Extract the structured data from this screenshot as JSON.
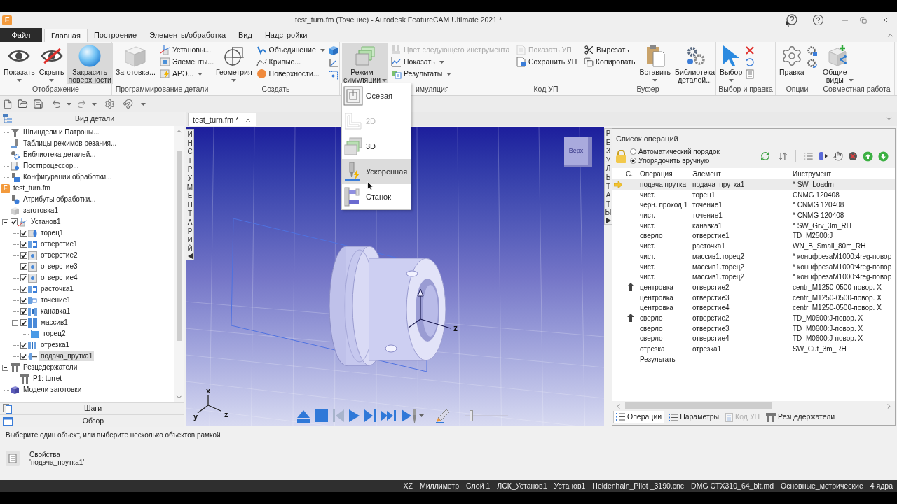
{
  "window": {
    "logo": "F",
    "title": "test_turn.fm (Точение) - Autodesk FeatureCAM Ultimate 2021 *"
  },
  "ribbon_tabs": [
    {
      "kind": "file",
      "label": "Файл",
      "selected": false
    },
    {
      "kind": "tab",
      "label": "Главная",
      "selected": true
    },
    {
      "kind": "tab",
      "label": "Построение",
      "selected": false
    },
    {
      "kind": "tab",
      "label": "Элементы/обработка",
      "selected": false
    },
    {
      "kind": "tab",
      "label": "Вид",
      "selected": false
    },
    {
      "kind": "tab",
      "label": "Надстройки",
      "selected": false
    }
  ],
  "ribbon_groups": [
    {
      "label": "Отображение",
      "buttons": [
        {
          "kind": "large",
          "label": "Показать",
          "caret": true,
          "selected": false
        },
        {
          "kind": "large",
          "label": "Скрыть",
          "caret": true,
          "selected": false
        },
        {
          "kind": "large",
          "label": "Закрасить поверхности",
          "selected": true
        }
      ]
    },
    {
      "label": "Программирование детали",
      "buttons": [
        {
          "kind": "large",
          "label": "Заготовка...",
          "selected": false
        },
        {
          "kind": "small",
          "label": "Установы...",
          "disabled": false
        },
        {
          "kind": "small",
          "label": "Элементы...",
          "disabled": false
        },
        {
          "kind": "small",
          "label": "АРЭ...",
          "caret": true,
          "disabled": false
        }
      ]
    },
    {
      "label": "Создать",
      "buttons": [
        {
          "kind": "large",
          "label": "Геометрия",
          "caret": true,
          "selected": false
        },
        {
          "kind": "small",
          "label": "Объединение",
          "caret": true,
          "disabled": false
        },
        {
          "kind": "small",
          "label": "Кривые...",
          "disabled": false
        },
        {
          "kind": "small",
          "label": "Поверхности...",
          "disabled": false
        },
        {
          "kind": "icon"
        },
        {
          "kind": "icon"
        },
        {
          "kind": "icon"
        }
      ]
    },
    {
      "label": "имуляция",
      "buttons": [
        {
          "kind": "large",
          "label": "Режим симуляции",
          "caret": true,
          "selected": true
        },
        {
          "kind": "small",
          "label": "Цвет следующего инструмента",
          "disabled": true
        },
        {
          "kind": "small",
          "label": "Показать",
          "caret": true,
          "disabled": false
        },
        {
          "kind": "small",
          "label": "Результаты",
          "caret": true,
          "disabled": false
        }
      ]
    },
    {
      "label": "Код УП",
      "buttons": [
        {
          "kind": "small",
          "label": "Показать УП",
          "disabled": true
        },
        {
          "kind": "small",
          "label": "Сохранить УП",
          "disabled": false
        }
      ]
    },
    {
      "label": "Буфер",
      "buttons": [
        {
          "kind": "small",
          "label": "Вырезать",
          "disabled": false
        },
        {
          "kind": "small",
          "label": "Копировать",
          "disabled": false
        },
        {
          "kind": "large",
          "label": "Вставить",
          "caret": true,
          "selected": false
        },
        {
          "kind": "large",
          "label": "Библиотека деталей...",
          "selected": false
        }
      ]
    },
    {
      "label": "Выбор и правка",
      "buttons": [
        {
          "kind": "large",
          "label": "Выбор",
          "caret": true,
          "selected": false
        },
        {
          "kind": "icon"
        },
        {
          "kind": "icon"
        },
        {
          "kind": "icon"
        }
      ]
    },
    {
      "label": "Опции",
      "buttons": [
        {
          "kind": "large",
          "label": "Правка",
          "selected": false
        },
        {
          "kind": "icon"
        },
        {
          "kind": "icon"
        }
      ]
    },
    {
      "label": "Совместная работа",
      "buttons": [
        {
          "kind": "large",
          "label": "Общие виды",
          "caret": true,
          "selected": false
        }
      ]
    }
  ],
  "simulation_menu": [
    {
      "label": "Осевая",
      "disabled": false,
      "highlighted": false
    },
    {
      "label": "2D",
      "disabled": true,
      "highlighted": false
    },
    {
      "label": "3D",
      "disabled": false,
      "highlighted": false
    },
    {
      "label": "Ускоренная",
      "disabled": false,
      "highlighted": true
    },
    {
      "label": "Станок",
      "disabled": false,
      "highlighted": false
    }
  ],
  "part_tree": {
    "title": "Вид детали",
    "leading_items": [
      {
        "kind": "spindle",
        "label": "Шпиндели и Патроны...",
        "selected": false
      },
      {
        "kind": "cutting-data",
        "label": "Таблицы режимов резания...",
        "selected": false
      },
      {
        "kind": "library",
        "label": "Библиотека деталей...",
        "selected": false
      },
      {
        "kind": "postprocessor",
        "label": "Постпроцессор...",
        "selected": false
      },
      {
        "kind": "machining-config",
        "label": "Конфигурации обработки...",
        "selected": false
      }
    ],
    "documents": [
      {
        "kind": "file",
        "logo": "F",
        "label": "test_turn.fm",
        "selected": false,
        "children": [
          {
            "kind": "attributes",
            "label": "Атрибуты обработки...",
            "selected": false
          },
          {
            "kind": "stock",
            "label": "заготовка1",
            "selected": false
          },
          {
            "kind": "setup",
            "label": "Установ1",
            "checked": true,
            "expanded": true,
            "selected": false,
            "children": [
              {
                "kind": "face",
                "label": "торец1",
                "checked": true,
                "selected": false
              },
              {
                "kind": "bore",
                "label": "отверстие1",
                "checked": true,
                "selected": false
              },
              {
                "kind": "hole",
                "label": "отверстие2",
                "checked": true,
                "selected": false
              },
              {
                "kind": "hole",
                "label": "отверстие3",
                "checked": true,
                "selected": false
              },
              {
                "kind": "hole",
                "label": "отверстие4",
                "checked": true,
                "selected": false
              },
              {
                "kind": "bore",
                "label": "расточка1",
                "checked": true,
                "selected": false
              },
              {
                "kind": "turn",
                "label": "точение1",
                "checked": true,
                "selected": false
              },
              {
                "kind": "groove",
                "label": "канавка1",
                "checked": true,
                "selected": false
              },
              {
                "kind": "pattern",
                "label": "массив1",
                "checked": true,
                "expanded": true,
                "selected": false,
                "children": [
                  {
                    "kind": "solid-face",
                    "label": "торец2",
                    "selected": false
                  }
                ]
              },
              {
                "kind": "cutoff",
                "label": "отрезка1",
                "checked": true,
                "selected": false
              },
              {
                "kind": "bar-feed",
                "label": "подача_прутка1",
                "checked": true,
                "selected": true
              }
            ]
          },
          {
            "kind": "turret",
            "label": "Резцедержатели",
            "expanded": true,
            "selected": false,
            "children": [
              {
                "kind": "turret",
                "label": "P1: turret",
                "selected": false
              }
            ]
          },
          {
            "kind": "stock-model",
            "label": "Модели заготовки",
            "selected": false
          }
        ]
      }
    ],
    "footer_tabs": [
      {
        "kind": "steps",
        "label": "Шаги"
      },
      {
        "kind": "overview",
        "label": "Обзор"
      }
    ]
  },
  "document_tabs": [
    {
      "label": "test_turn.fm *",
      "selected": true
    }
  ],
  "viewport": {
    "left_dock": "ИНСТРУМЕНТАРИЙ",
    "right_dock": "РЕЗУЛЬТАТЫ",
    "view_cube": "Верх",
    "part_axis_label": "z",
    "triad": {
      "x": "x",
      "y": "y",
      "z": "z"
    },
    "sim_controls": [
      {
        "kind": "eject",
        "disabled": false
      },
      {
        "kind": "stop",
        "disabled": false
      },
      {
        "kind": "step-back",
        "disabled": true
      },
      {
        "kind": "play",
        "disabled": false
      },
      {
        "kind": "step",
        "disabled": false
      },
      {
        "kind": "skip",
        "disabled": false
      },
      {
        "kind": "to-tool",
        "disabled": false
      },
      {
        "kind": "eraser",
        "disabled": false
      }
    ],
    "speed": {
      "level": 0.15
    }
  },
  "operations": {
    "title": "Список операций",
    "order_options": [
      {
        "label": "Автоматический порядок",
        "selected": false
      },
      {
        "label": "Упорядочить вручную",
        "selected": true
      }
    ],
    "columns": [
      "С.",
      "Операция",
      "Элемент",
      "Инструмент"
    ],
    "rows": [
      {
        "current": true,
        "moved": false,
        "operation": "подача прутка",
        "feature": "подача_прутка1",
        "tool": "* SW_Loadm",
        "selected": true
      },
      {
        "current": false,
        "moved": false,
        "operation": "чист.",
        "feature": "торец1",
        "tool": "CNMG 120408",
        "selected": false
      },
      {
        "current": false,
        "moved": false,
        "operation": "черн. проход 1",
        "feature": "точение1",
        "tool": "* CNMG 120408",
        "selected": false
      },
      {
        "current": false,
        "moved": false,
        "operation": "чист.",
        "feature": "точение1",
        "tool": "* CNMG 120408",
        "selected": false
      },
      {
        "current": false,
        "moved": false,
        "operation": "чист.",
        "feature": "канавка1",
        "tool": "* SW_Grv_3m_RH",
        "selected": false
      },
      {
        "current": false,
        "moved": false,
        "operation": "сверло",
        "feature": "отверстие1",
        "tool": "TD_M2500:J",
        "selected": false
      },
      {
        "current": false,
        "moved": false,
        "operation": "чист.",
        "feature": "расточка1",
        "tool": "WN_B_Small_80m_RH",
        "selected": false
      },
      {
        "current": false,
        "moved": false,
        "operation": "чист.",
        "feature": "массив1.торец2",
        "tool": "* концфрезаM1000:4reg-повор",
        "selected": false
      },
      {
        "current": false,
        "moved": false,
        "operation": "чист.",
        "feature": "массив1.торец2",
        "tool": "* концфрезаM1000:4reg-повор",
        "selected": false
      },
      {
        "current": false,
        "moved": false,
        "operation": "чист.",
        "feature": "массив1.торец2",
        "tool": "* концфрезаM1000:4reg-повор",
        "selected": false
      },
      {
        "current": false,
        "moved": true,
        "operation": "центровка",
        "feature": "отверстие2",
        "tool": "centr_M1250-0500-повор. X",
        "selected": false
      },
      {
        "current": false,
        "moved": false,
        "operation": "центровка",
        "feature": "отверстие3",
        "tool": "centr_M1250-0500-повор. X",
        "selected": false
      },
      {
        "current": false,
        "moved": false,
        "operation": "центровка",
        "feature": "отверстие4",
        "tool": "centr_M1250-0500-повор. X",
        "selected": false
      },
      {
        "current": false,
        "moved": true,
        "operation": "сверло",
        "feature": "отверстие2",
        "tool": "TD_M0600:J-повор. X",
        "selected": false
      },
      {
        "current": false,
        "moved": false,
        "operation": "сверло",
        "feature": "отверстие3",
        "tool": "TD_M0600:J-повор. X",
        "selected": false
      },
      {
        "current": false,
        "moved": false,
        "operation": "сверло",
        "feature": "отверстие4",
        "tool": "TD_M0600:J-повор. X",
        "selected": false
      },
      {
        "current": false,
        "moved": false,
        "operation": "отрезка",
        "feature": "отрезка1",
        "tool": "SW_Cut_3m_RH",
        "selected": false
      },
      {
        "current": false,
        "moved": false,
        "operation": "Результаты",
        "selected": false
      }
    ],
    "tabs": [
      {
        "label": "Операции",
        "selected": true,
        "disabled": false
      },
      {
        "label": "Параметры",
        "selected": false,
        "disabled": false
      },
      {
        "label": "Код УП",
        "selected": false,
        "disabled": true
      },
      {
        "label": "Резцедержатели",
        "selected": false,
        "disabled": false
      }
    ]
  },
  "message": "Выберите один объект, или выберите несколько объектов рамкой",
  "properties": {
    "title": "Свойства",
    "value": "'подача_прутка1'"
  },
  "status_bar": [
    "XZ",
    "Миллиметр",
    "Слой 1",
    "ЛСК_Установ1",
    "Установ1",
    "Heidenhain_Pilot _3190.cnc",
    "DMG CTX310_64_bit.md",
    "Основные_метрические",
    "4 ядра"
  ]
}
